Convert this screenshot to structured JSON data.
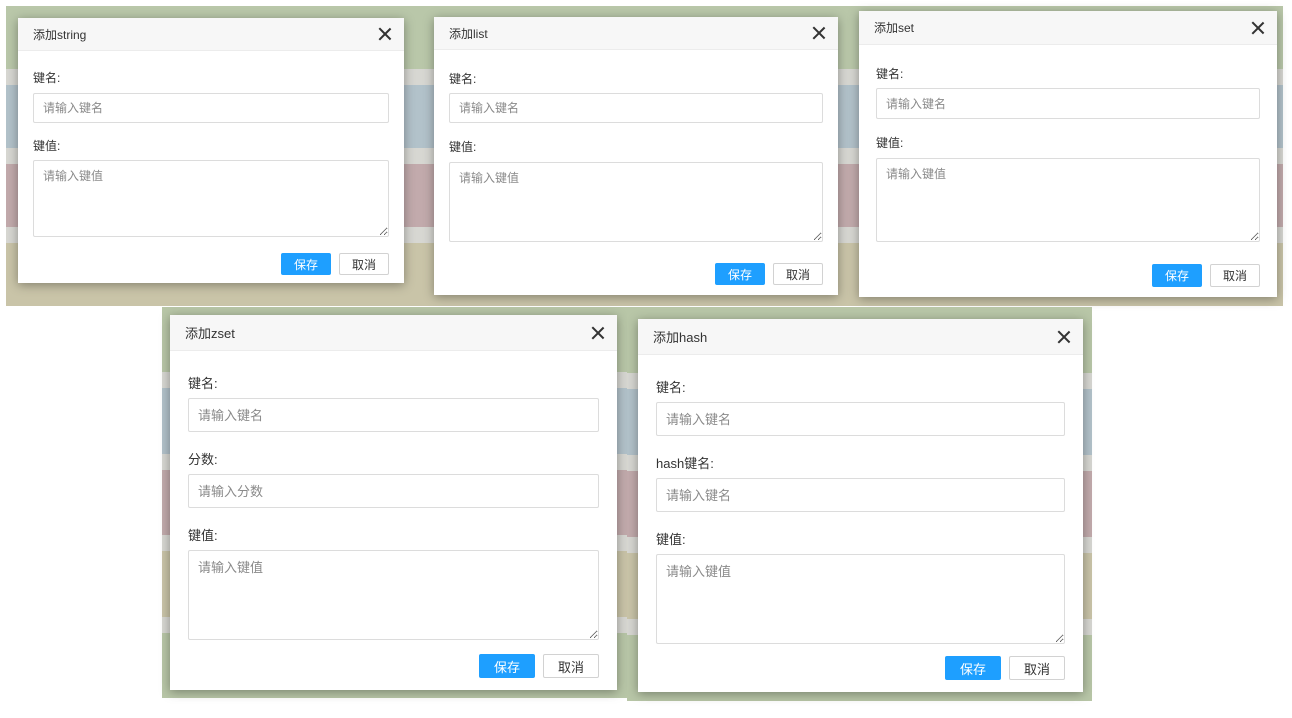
{
  "dialogs": {
    "string": {
      "title": "添加string",
      "key_label": "键名:",
      "key_placeholder": "请输入键名",
      "value_label": "键值:",
      "value_placeholder": "请输入键值",
      "save": "保存",
      "cancel": "取消"
    },
    "list": {
      "title": "添加list",
      "key_label": "键名:",
      "key_placeholder": "请输入键名",
      "value_label": "键值:",
      "value_placeholder": "请输入键值",
      "save": "保存",
      "cancel": "取消"
    },
    "set": {
      "title": "添加set",
      "key_label": "键名:",
      "key_placeholder": "请输入键名",
      "value_label": "键值:",
      "value_placeholder": "请输入键值",
      "save": "保存",
      "cancel": "取消"
    },
    "zset": {
      "title": "添加zset",
      "key_label": "键名:",
      "key_placeholder": "请输入键名",
      "score_label": "分数:",
      "score_placeholder": "请输入分数",
      "value_label": "键值:",
      "value_placeholder": "请输入键值",
      "save": "保存",
      "cancel": "取消"
    },
    "hash": {
      "title": "添加hash",
      "key_label": "键名:",
      "key_placeholder": "请输入键名",
      "hash_key_label": "hash键名:",
      "hash_key_placeholder": "请输入键名",
      "value_label": "键值:",
      "value_placeholder": "请输入键值",
      "save": "保存",
      "cancel": "取消"
    }
  },
  "colors": {
    "primary_button": "#1e9fff",
    "header_background": "#f7f7f7"
  },
  "icons": [
    "close-icon"
  ]
}
